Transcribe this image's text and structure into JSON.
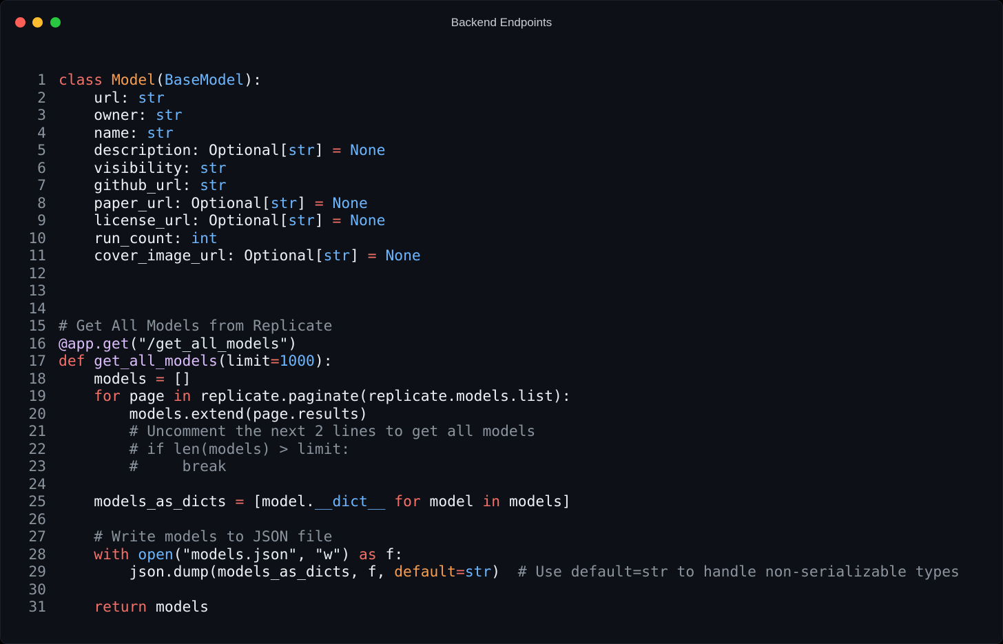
{
  "window": {
    "title": "Backend Endpoints"
  },
  "colors": {
    "keyword": "#f47067",
    "classname": "#f69d50",
    "type": "#6cb6ff",
    "builtin": "#96d0ff",
    "string": "#e6edf3",
    "number": "#6cb6ff",
    "comment": "#8b949e",
    "decorator": "#dcbdfb",
    "plain": "#eef1f4"
  },
  "code_lines": [
    {
      "n": "1",
      "tokens": [
        [
          "class",
          "keyword"
        ],
        [
          " ",
          "plain"
        ],
        [
          "Model",
          "classname"
        ],
        [
          "(",
          "plain"
        ],
        [
          "BaseModel",
          "type"
        ],
        [
          "):",
          "plain"
        ]
      ]
    },
    {
      "n": "2",
      "tokens": [
        [
          "    url: ",
          "plain"
        ],
        [
          "str",
          "type"
        ]
      ]
    },
    {
      "n": "3",
      "tokens": [
        [
          "    owner: ",
          "plain"
        ],
        [
          "str",
          "type"
        ]
      ]
    },
    {
      "n": "4",
      "tokens": [
        [
          "    name: ",
          "plain"
        ],
        [
          "str",
          "type"
        ]
      ]
    },
    {
      "n": "5",
      "tokens": [
        [
          "    description: Optional[",
          "plain"
        ],
        [
          "str",
          "type"
        ],
        [
          "] ",
          "plain"
        ],
        [
          "=",
          "keyword"
        ],
        [
          " ",
          "plain"
        ],
        [
          "None",
          "type"
        ]
      ]
    },
    {
      "n": "6",
      "tokens": [
        [
          "    visibility: ",
          "plain"
        ],
        [
          "str",
          "type"
        ]
      ]
    },
    {
      "n": "7",
      "tokens": [
        [
          "    github_url: ",
          "plain"
        ],
        [
          "str",
          "type"
        ]
      ]
    },
    {
      "n": "8",
      "tokens": [
        [
          "    paper_url: Optional[",
          "plain"
        ],
        [
          "str",
          "type"
        ],
        [
          "] ",
          "plain"
        ],
        [
          "=",
          "keyword"
        ],
        [
          " ",
          "plain"
        ],
        [
          "None",
          "type"
        ]
      ]
    },
    {
      "n": "9",
      "tokens": [
        [
          "    license_url: Optional[",
          "plain"
        ],
        [
          "str",
          "type"
        ],
        [
          "] ",
          "plain"
        ],
        [
          "=",
          "keyword"
        ],
        [
          " ",
          "plain"
        ],
        [
          "None",
          "type"
        ]
      ]
    },
    {
      "n": "10",
      "tokens": [
        [
          "    run_count: ",
          "plain"
        ],
        [
          "int",
          "type"
        ]
      ]
    },
    {
      "n": "11",
      "tokens": [
        [
          "    cover_image_url: Optional[",
          "plain"
        ],
        [
          "str",
          "type"
        ],
        [
          "] ",
          "plain"
        ],
        [
          "=",
          "keyword"
        ],
        [
          " ",
          "plain"
        ],
        [
          "None",
          "type"
        ]
      ]
    },
    {
      "n": "12",
      "tokens": []
    },
    {
      "n": "13",
      "tokens": []
    },
    {
      "n": "14",
      "tokens": []
    },
    {
      "n": "15",
      "tokens": [
        [
          "# Get All Models from Replicate",
          "comment"
        ]
      ]
    },
    {
      "n": "16",
      "tokens": [
        [
          "@app.get",
          "decorator"
        ],
        [
          "(",
          "plain"
        ],
        [
          "\"/get_all_models\"",
          "string"
        ],
        [
          ")",
          "plain"
        ]
      ]
    },
    {
      "n": "17",
      "tokens": [
        [
          "def",
          "keyword"
        ],
        [
          " ",
          "plain"
        ],
        [
          "get_all_models",
          "decorator"
        ],
        [
          "(limit",
          "plain"
        ],
        [
          "=",
          "keyword"
        ],
        [
          "1000",
          "number"
        ],
        [
          "):",
          "plain"
        ]
      ]
    },
    {
      "n": "18",
      "tokens": [
        [
          "    models ",
          "plain"
        ],
        [
          "=",
          "keyword"
        ],
        [
          " []",
          "plain"
        ]
      ]
    },
    {
      "n": "19",
      "tokens": [
        [
          "    ",
          "plain"
        ],
        [
          "for",
          "keyword"
        ],
        [
          " page ",
          "plain"
        ],
        [
          "in",
          "keyword"
        ],
        [
          " replicate.paginate(replicate.models.list):",
          "plain"
        ]
      ]
    },
    {
      "n": "20",
      "tokens": [
        [
          "        models.extend(page.results)",
          "plain"
        ]
      ]
    },
    {
      "n": "21",
      "tokens": [
        [
          "        ",
          "plain"
        ],
        [
          "# Uncomment the next 2 lines to get all models",
          "comment"
        ]
      ]
    },
    {
      "n": "22",
      "tokens": [
        [
          "        ",
          "plain"
        ],
        [
          "# if len(models) > limit:",
          "comment"
        ]
      ]
    },
    {
      "n": "23",
      "tokens": [
        [
          "        ",
          "plain"
        ],
        [
          "#     break",
          "comment"
        ]
      ]
    },
    {
      "n": "24",
      "tokens": []
    },
    {
      "n": "25",
      "tokens": [
        [
          "    models_as_dicts ",
          "plain"
        ],
        [
          "=",
          "keyword"
        ],
        [
          " [model.",
          "plain"
        ],
        [
          "__dict__",
          "type"
        ],
        [
          " ",
          "plain"
        ],
        [
          "for",
          "keyword"
        ],
        [
          " model ",
          "plain"
        ],
        [
          "in",
          "keyword"
        ],
        [
          " models]",
          "plain"
        ]
      ]
    },
    {
      "n": "26",
      "tokens": []
    },
    {
      "n": "27",
      "tokens": [
        [
          "    ",
          "plain"
        ],
        [
          "# Write models to JSON file",
          "comment"
        ]
      ]
    },
    {
      "n": "28",
      "tokens": [
        [
          "    ",
          "plain"
        ],
        [
          "with",
          "keyword"
        ],
        [
          " ",
          "plain"
        ],
        [
          "open",
          "type"
        ],
        [
          "(",
          "plain"
        ],
        [
          "\"models.json\"",
          "string"
        ],
        [
          ", ",
          "plain"
        ],
        [
          "\"w\"",
          "string"
        ],
        [
          ") ",
          "plain"
        ],
        [
          "as",
          "keyword"
        ],
        [
          " f:",
          "plain"
        ]
      ]
    },
    {
      "n": "29",
      "tokens": [
        [
          "        json.dump(models_as_dicts, f, ",
          "plain"
        ],
        [
          "default",
          "classname"
        ],
        [
          "=",
          "keyword"
        ],
        [
          "str",
          "type"
        ],
        [
          ")  ",
          "plain"
        ],
        [
          "# Use default=str to handle non-serializable types",
          "comment"
        ]
      ]
    },
    {
      "n": "30",
      "tokens": []
    },
    {
      "n": "31",
      "tokens": [
        [
          "    ",
          "plain"
        ],
        [
          "return",
          "keyword"
        ],
        [
          " models",
          "plain"
        ]
      ]
    }
  ]
}
